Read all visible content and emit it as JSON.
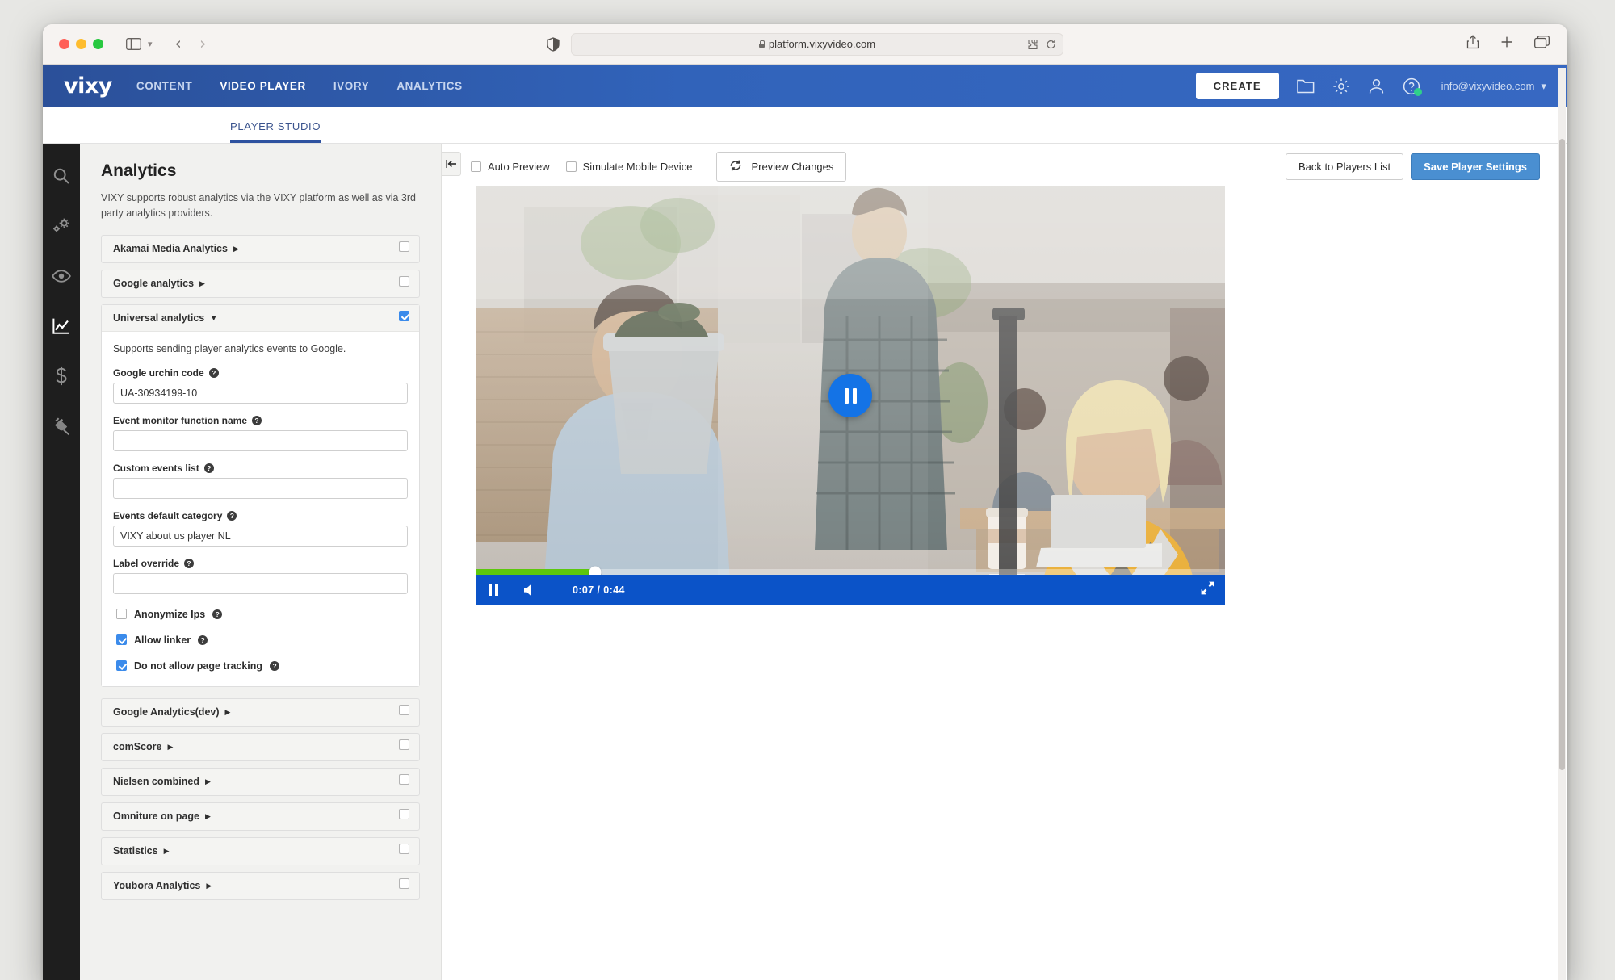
{
  "browser": {
    "url": "platform.vixyvideo.com",
    "traffic_lights": [
      "close",
      "minimize",
      "maximize"
    ],
    "icons": {
      "sidebar": "sidebar-icon",
      "chevron": "chevron-down-icon",
      "back": "back-arrow-icon",
      "forward": "forward-arrow-icon",
      "shield": "shield-icon",
      "lock": "lock-icon",
      "extensions": "puzzle-extension-icon",
      "reload": "reload-icon",
      "share": "share-icon",
      "newtab": "plus-icon",
      "tabs": "tab-overview-icon"
    }
  },
  "appnav": {
    "logo": "vixy",
    "links": [
      {
        "label": "CONTENT",
        "active": false
      },
      {
        "label": "VIDEO PLAYER",
        "active": true
      },
      {
        "label": "IVORY",
        "active": false
      },
      {
        "label": "ANALYTICS",
        "active": false
      }
    ],
    "create_label": "CREATE",
    "icons": [
      "folder-icon",
      "gear-icon",
      "user-icon",
      "help-icon"
    ],
    "account": "info@vixyvideo.com"
  },
  "subnav": {
    "tabs": [
      {
        "label": "PLAYER STUDIO",
        "active": true
      }
    ]
  },
  "rail": {
    "items": [
      {
        "name": "search-icon",
        "active": false
      },
      {
        "name": "settings-gears-icon",
        "active": false
      },
      {
        "name": "eye-icon",
        "active": false
      },
      {
        "name": "analytics-chart-icon",
        "active": true
      },
      {
        "name": "monetization-dollar-icon",
        "active": false
      },
      {
        "name": "plugin-plug-icon",
        "active": false
      }
    ]
  },
  "panel": {
    "title": "Analytics",
    "description": "VIXY supports robust analytics via the VIXY platform as well as via 3rd party analytics providers.",
    "sections_top": [
      {
        "label": "Akamai Media Analytics",
        "caret": "▶",
        "open": false,
        "checked": false
      },
      {
        "label": "Google analytics",
        "caret": "▶",
        "open": false,
        "checked": false
      }
    ],
    "open_section": {
      "label": "Universal analytics",
      "caret": "▼",
      "open": true,
      "checked": true,
      "note": "Supports sending player analytics events to Google.",
      "fields": [
        {
          "label": "Google urchin code",
          "value": "UA-30934199-10",
          "placeholder": ""
        },
        {
          "label": "Event monitor function name",
          "value": "",
          "placeholder": ""
        },
        {
          "label": "Custom events list",
          "value": "",
          "placeholder": ""
        },
        {
          "label": "Events default category",
          "value": "VIXY about us player NL",
          "placeholder": ""
        },
        {
          "label": "Label override",
          "value": "",
          "placeholder": ""
        }
      ],
      "checkboxes": [
        {
          "label": "Anonymize Ips",
          "checked": false
        },
        {
          "label": "Allow linker",
          "checked": true
        },
        {
          "label": "Do not allow page tracking",
          "checked": true
        }
      ]
    },
    "sections_bottom": [
      {
        "label": "Google Analytics(dev)",
        "caret": "▶",
        "open": false,
        "checked": false
      },
      {
        "label": "comScore",
        "caret": "▶",
        "open": false,
        "checked": false
      },
      {
        "label": "Nielsen combined",
        "caret": "▶",
        "open": false,
        "checked": false
      },
      {
        "label": "Omniture on page",
        "caret": "▶",
        "open": false,
        "checked": false
      },
      {
        "label": "Statistics",
        "caret": "▶",
        "open": false,
        "checked": false
      },
      {
        "label": "Youbora Analytics",
        "caret": "▶",
        "open": false,
        "checked": false
      }
    ]
  },
  "preview_toolbar": {
    "collapse_icon": "collapse-left-icon",
    "auto_preview": {
      "label": "Auto Preview",
      "checked": false
    },
    "simulate_mobile": {
      "label": "Simulate Mobile Device",
      "checked": false
    },
    "preview_changes": {
      "label": "Preview Changes",
      "icon": "refresh-icon"
    },
    "back_button": "Back to Players List",
    "save_button": "Save Player Settings"
  },
  "player": {
    "state": "playing",
    "center_button": "pause-icon",
    "current_time": "0:07",
    "duration": "0:44",
    "time_separator": "/",
    "progress_percent": 16,
    "progress_color": "#5cc70d",
    "controlbar_color": "#0b53c8",
    "controls": [
      "pause-icon",
      "volume-icon",
      "fullscreen-icon"
    ]
  },
  "colors": {
    "brand_blue": "#3163ba",
    "accent_blue": "#4a8fd1",
    "checkbox_blue": "#3b8beb",
    "progress_green": "#5cc70d",
    "status_green": "#2fd08a"
  }
}
